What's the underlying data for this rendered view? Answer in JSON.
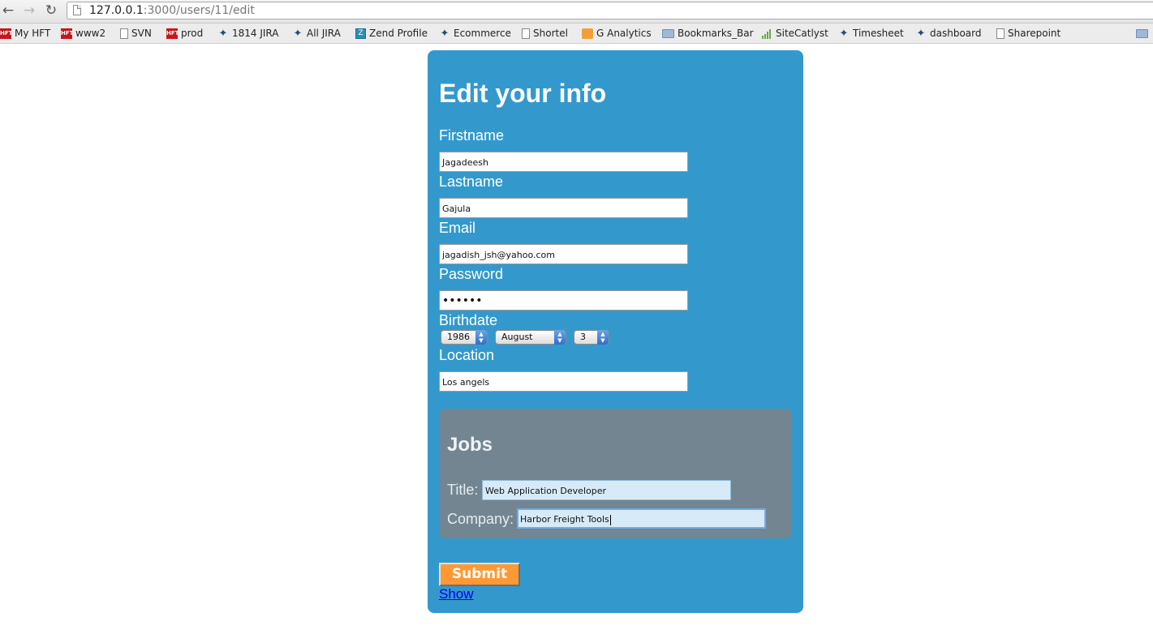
{
  "browser": {
    "url_host": "127.0.0.1",
    "url_rest": ":3000/users/11/edit",
    "bookmarks": [
      {
        "label": "My HFT",
        "icon": "hft-icon"
      },
      {
        "label": "www2",
        "icon": "hft-icon"
      },
      {
        "label": "SVN",
        "icon": "page-icon"
      },
      {
        "label": "prod",
        "icon": "hft-icon"
      },
      {
        "label": "1814 JIRA",
        "icon": "jira-icon"
      },
      {
        "label": "All JIRA",
        "icon": "jira-icon"
      },
      {
        "label": "Zend Profile",
        "icon": "zend-icon"
      },
      {
        "label": "Ecommerce",
        "icon": "jira-icon"
      },
      {
        "label": "Shortel",
        "icon": "page-icon"
      },
      {
        "label": "G Analytics",
        "icon": "analytics-icon"
      },
      {
        "label": "Bookmarks_Bar",
        "icon": "folder-icon"
      },
      {
        "label": "SiteCatlyst",
        "icon": "bar-chart-icon"
      },
      {
        "label": "Timesheet",
        "icon": "jira-icon"
      },
      {
        "label": "dashboard",
        "icon": "jira-icon"
      },
      {
        "label": "Sharepoint",
        "icon": "page-icon"
      }
    ],
    "hft_text": "HFT"
  },
  "form": {
    "heading": "Edit your info",
    "firstname": {
      "label": "Firstname",
      "value": "Jagadeesh"
    },
    "lastname": {
      "label": "Lastname",
      "value": "Gajula"
    },
    "email": {
      "label": "Email",
      "value": "jagadish_jsh@yahoo.com"
    },
    "password": {
      "label": "Password",
      "value": "••••••"
    },
    "birthdate": {
      "label": "Birthdate",
      "year": "1986",
      "month": "August",
      "day": "3"
    },
    "location": {
      "label": "Location",
      "value": "Los angels"
    },
    "jobs": {
      "heading": "Jobs",
      "title_label": "Title:",
      "title_value": "Web Application Developer",
      "company_label": "Company:",
      "company_value": "Harbor Freight Tools"
    },
    "submit_label": "Submit",
    "show_link": "Show"
  },
  "colors": {
    "panel": "#3399cc",
    "jobs_panel": "#738591",
    "submit": "#ff9933"
  }
}
